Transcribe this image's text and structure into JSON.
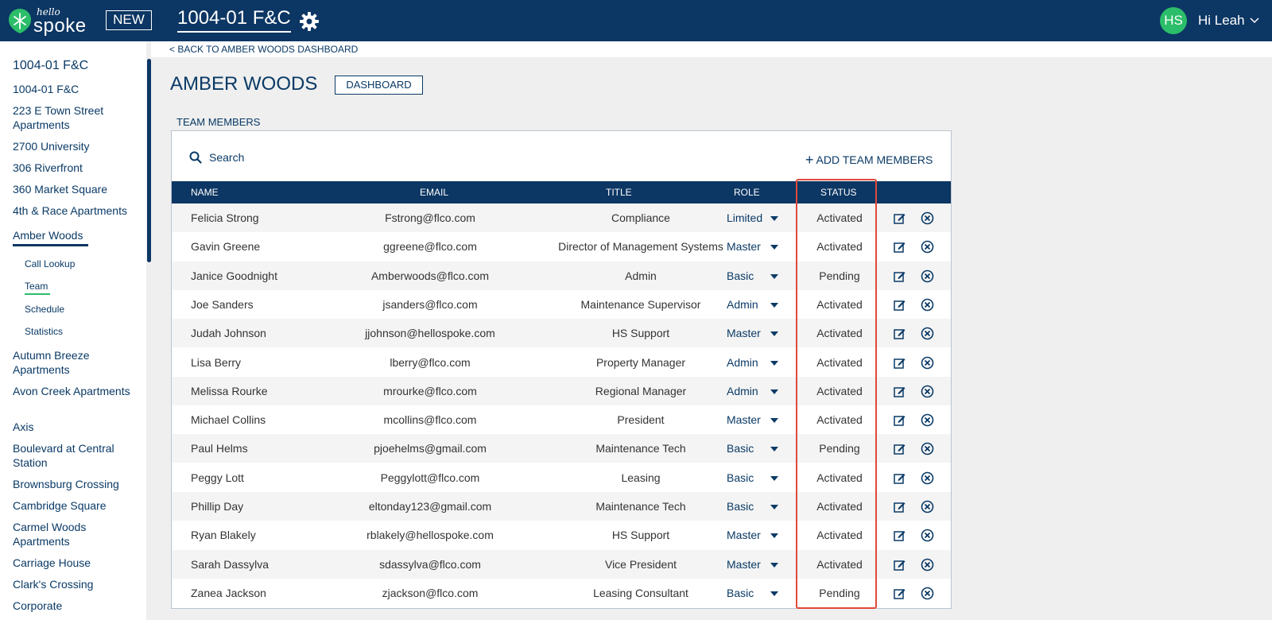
{
  "header": {
    "logo_top": "hello",
    "logo_main": "spoke",
    "new_label": "NEW",
    "app_title": "1004-01 F&C",
    "avatar_initials": "HS",
    "greeting": "Hi Leah"
  },
  "sidebar": {
    "items": [
      "1004-01 F&C",
      "1004-01 F&C",
      "223 E Town Street Apartments",
      "2700 University",
      "306 Riverfront",
      "360 Market Square",
      "4th & Race Apartments",
      "Amber Woods",
      "Autumn Breeze Apartments",
      "Avon Creek Apartments",
      "Axis",
      "Boulevard at Central Station",
      "Brownsburg Crossing",
      "Cambridge Square",
      "Carmel Woods Apartments",
      "Carriage House",
      "Clark's Crossing",
      "Corporate"
    ],
    "subitems": [
      "Call Lookup",
      "Team",
      "Schedule",
      "Statistics"
    ]
  },
  "main": {
    "back_link": "< BACK TO AMBER WOODS DASHBOARD",
    "title": "AMBER WOODS",
    "dashboard_label": "DASHBOARD",
    "section_label": "TEAM MEMBERS",
    "search_placeholder": "Search",
    "add_label": "ADD TEAM MEMBERS"
  },
  "table": {
    "columns": [
      "NAME",
      "EMAIL",
      "TITLE",
      "ROLE",
      "STATUS"
    ],
    "rows": [
      [
        "Felicia Strong",
        "Fstrong@flco.com",
        "Compliance",
        "Limited",
        "Activated"
      ],
      [
        "Gavin Greene",
        "ggreene@flco.com",
        "Director of Management Systems",
        "Master",
        "Activated"
      ],
      [
        "Janice Goodnight",
        "Amberwoods@flco.com",
        "Admin",
        "Basic",
        "Pending"
      ],
      [
        "Joe Sanders",
        "jsanders@flco.com",
        "Maintenance Supervisor",
        "Admin",
        "Activated"
      ],
      [
        "Judah Johnson",
        "jjohnson@hellospoke.com",
        "HS Support",
        "Master",
        "Activated"
      ],
      [
        "Lisa Berry",
        "lberry@flco.com",
        "Property Manager",
        "Admin",
        "Activated"
      ],
      [
        "Melissa Rourke",
        "mrourke@flco.com",
        "Regional Manager",
        "Admin",
        "Activated"
      ],
      [
        "Michael Collins",
        "mcollins@flco.com",
        "President",
        "Master",
        "Activated"
      ],
      [
        "Paul Helms",
        "pjoehelms@gmail.com",
        "Maintenance Tech",
        "Basic",
        "Pending"
      ],
      [
        "Peggy Lott",
        "Peggylott@flco.com",
        "Leasing",
        "Basic",
        "Activated"
      ],
      [
        "Phillip Day",
        "eltonday123@gmail.com",
        "Maintenance Tech",
        "Basic",
        "Activated"
      ],
      [
        "Ryan Blakely",
        "rblakely@hellospoke.com",
        "HS Support",
        "Master",
        "Activated"
      ],
      [
        "Sarah Dassylva",
        "sdassylva@flco.com",
        "Vice President",
        "Master",
        "Activated"
      ],
      [
        "Zanea Jackson",
        "zjackson@flco.com",
        "Leasing Consultant",
        "Basic",
        "Pending"
      ]
    ]
  },
  "colors": {
    "navy": "#0c3663",
    "green": "#2bbd69",
    "highlight": "#e0493a"
  }
}
